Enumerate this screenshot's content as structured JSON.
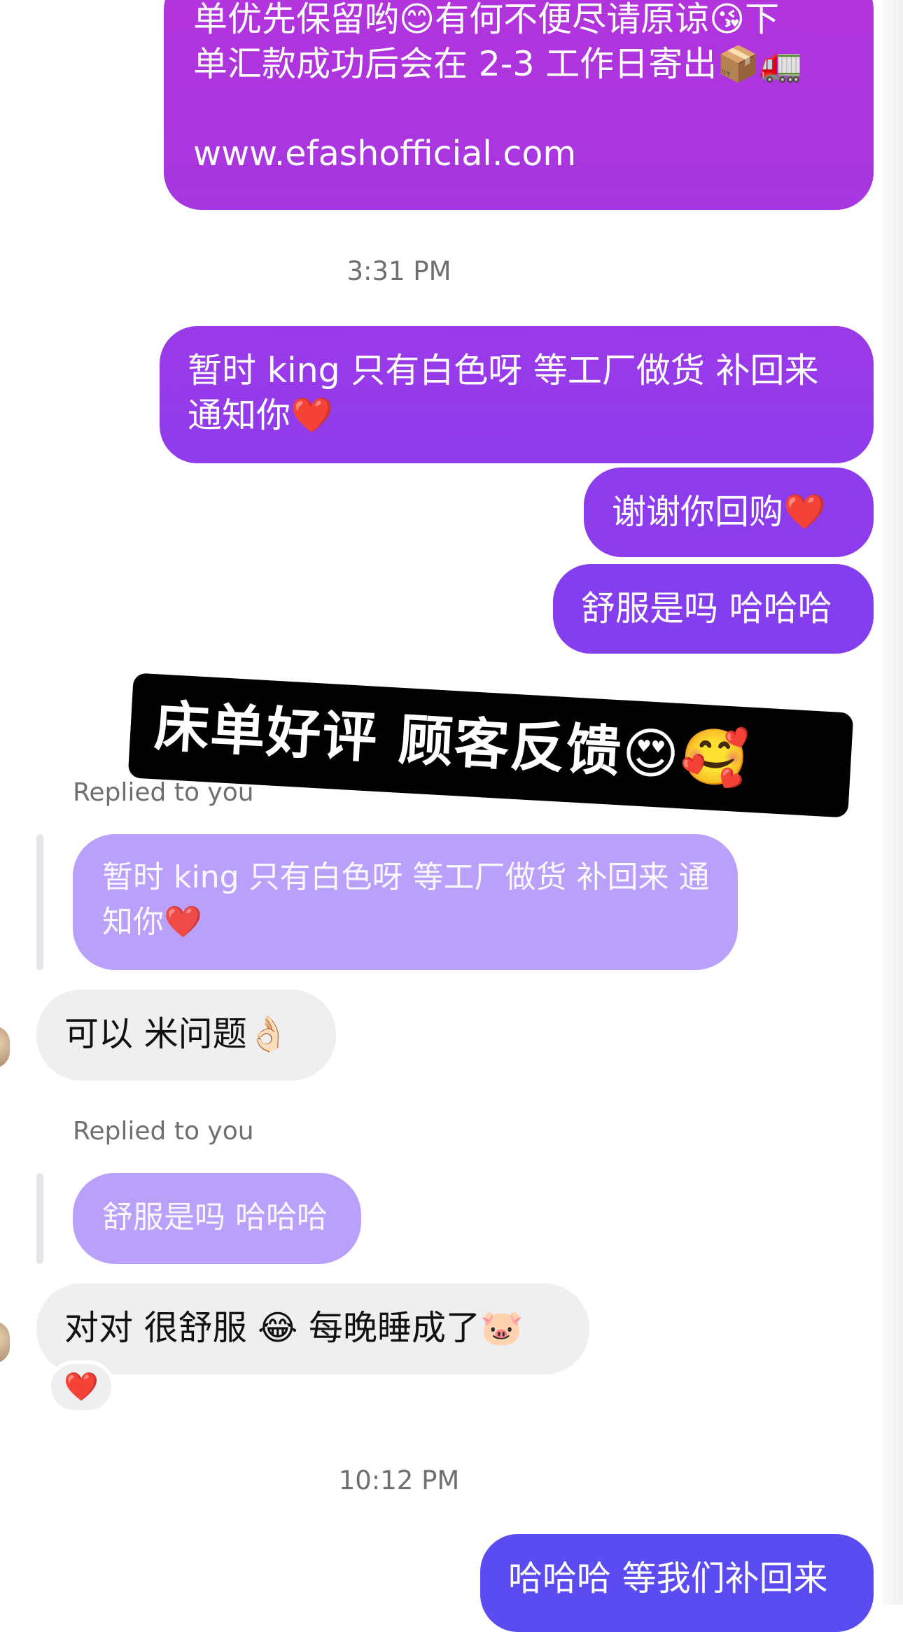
{
  "chat": {
    "messages": [
      {
        "line1": "单优先保留哟😊有何不便尽请原谅😘下",
        "line2": "单汇款成功后会在 2-3 工作日寄出📦🚛",
        "link": "www.efashofficial.com"
      },
      {
        "line1": "暂时 king 只有白色呀 等工厂做货 补回来",
        "line2": "通知你❤️"
      },
      {
        "text": "谢谢你回购❤️"
      },
      {
        "text": "舒服是吗 哈哈哈"
      },
      {
        "reply_label": "Replied to you",
        "line1": "暂时 king 只有白色呀 等工厂做货 补回来 通",
        "line2": "知你❤️"
      },
      {
        "text": "可以 米问题👌🏻"
      },
      {
        "reply_label": "Replied to you",
        "text": "舒服是吗 哈哈哈"
      },
      {
        "text": "对对 很舒服 😂 每晚睡成了🐷",
        "reaction": "❤️"
      },
      {
        "text": "哈哈哈 等我们补回来"
      }
    ],
    "timestamps": [
      "3:31 PM",
      "10:12 PM"
    ]
  },
  "banner": {
    "text": "床单好评 顾客反馈😍🥰"
  },
  "colors": {
    "gradient_top": "#a832d9",
    "gradient_mid": "#8b3cf0",
    "gradient_bottom": "#5b4cf2",
    "incoming_bg": "#efeff1",
    "reply_bg": "#b9a0fb",
    "banner_bg": "#000000"
  }
}
